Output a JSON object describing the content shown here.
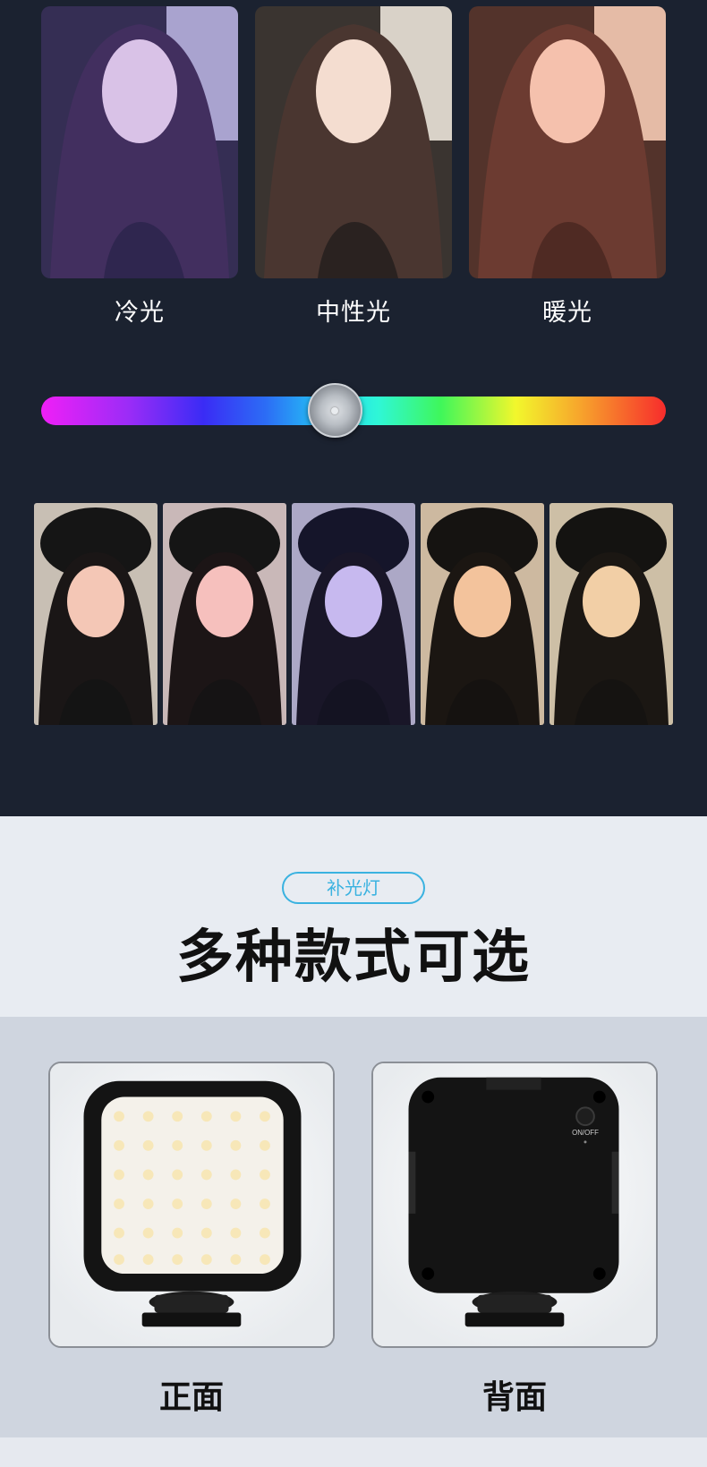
{
  "tones": [
    {
      "label": "冷光",
      "tint": "#b9b6f2"
    },
    {
      "label": "中性光",
      "tint": "#e6d2c1"
    },
    {
      "label": "暖光",
      "tint": "#f0b6a4"
    }
  ],
  "color_slider": {
    "position_fraction": 0.47
  },
  "strip_tints": [
    "#f4c7b6",
    "#f6c0bd",
    "#c7b9ef",
    "#f3c39c",
    "#f2cfa6"
  ],
  "section": {
    "pill": "补光灯",
    "heading": "多种款式可选"
  },
  "products": [
    {
      "label": "正面"
    },
    {
      "label": "背面",
      "button_text": "ON/OFF"
    }
  ]
}
